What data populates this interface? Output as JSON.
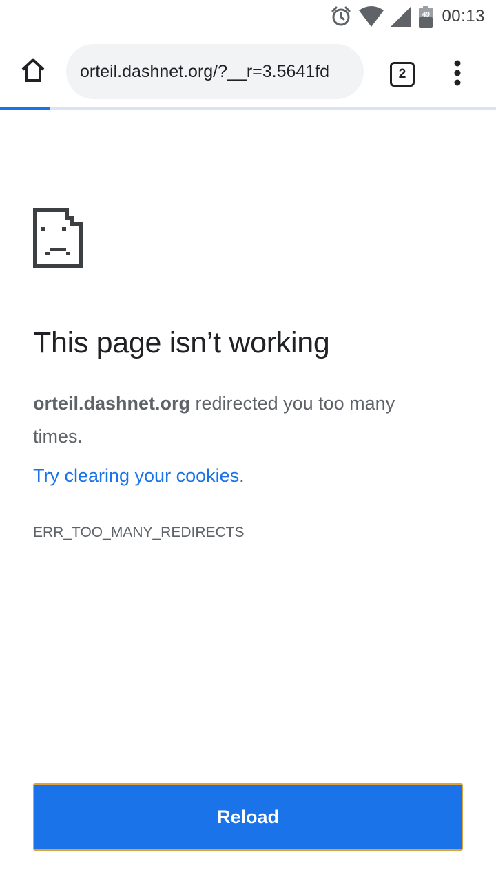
{
  "status_bar": {
    "time": "00:13",
    "battery_level": "49",
    "icons": [
      "alarm-icon",
      "wifi-icon",
      "cell-signal-icon",
      "battery-icon"
    ]
  },
  "toolbar": {
    "url": "orteil.dashnet.org/?__r=3.5641fd",
    "tab_count": "2",
    "load_progress_fraction": 0.1,
    "icons": [
      "home-icon",
      "more-vert-icon"
    ]
  },
  "error_page": {
    "icon": "sad-page-icon",
    "heading": "This page isn’t working",
    "host": "orteil.dashnet.org",
    "message": " redirected you too many times.",
    "suggestion_link": "Try clearing your cookies",
    "suggestion_suffix": ".",
    "error_code": "ERR_TOO_MANY_REDIRECTS",
    "reload_label": "Reload"
  },
  "colors": {
    "accent": "#1a73e8",
    "text_primary": "#202124",
    "text_secondary": "#5f6368",
    "url_bar_bg": "#f1f3f4"
  }
}
